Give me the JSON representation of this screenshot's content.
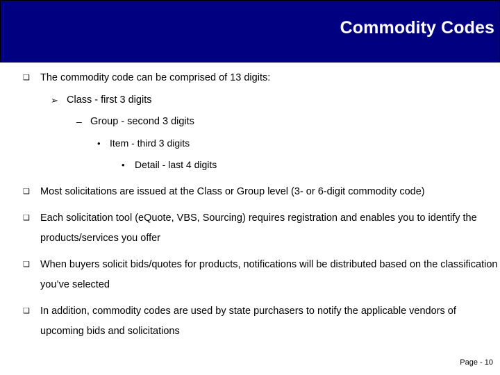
{
  "slide": {
    "title": "Commodity Codes",
    "title_bar_color": "#000080",
    "title_text_color": "#FFFFFF",
    "background_color": "#FFFFFF",
    "body_text_color": "#000000"
  },
  "bullets": {
    "markers": {
      "level1": "❑",
      "level2": "➢",
      "level3": "–",
      "level4": "•",
      "level5": "•"
    },
    "items": [
      {
        "level": 1,
        "text": "The commodity code can be comprised of 13 digits:"
      },
      {
        "level": 2,
        "text": "Class - first 3 digits"
      },
      {
        "level": 3,
        "text": "Group - second 3 digits"
      },
      {
        "level": 4,
        "text": "Item - third 3 digits"
      },
      {
        "level": 5,
        "text": "Detail - last 4 digits"
      },
      {
        "level": 1,
        "text": "Most solicitations are issued at the Class or Group level (3- or 6-digit commodity code)"
      },
      {
        "level": 1,
        "text": "Each solicitation tool (eQuote, VBS, Sourcing) requires registration and enables you to identify the products/services you offer"
      },
      {
        "level": 1,
        "text": "When buyers solicit bids/quotes for products, notifications will be distributed based on the classification you’ve selected"
      },
      {
        "level": 1,
        "text": "In addition, commodity codes are used by state purchasers to notify the applicable vendors of upcoming bids and solicitations"
      }
    ]
  },
  "footer": {
    "page_label": "Page - 10"
  }
}
